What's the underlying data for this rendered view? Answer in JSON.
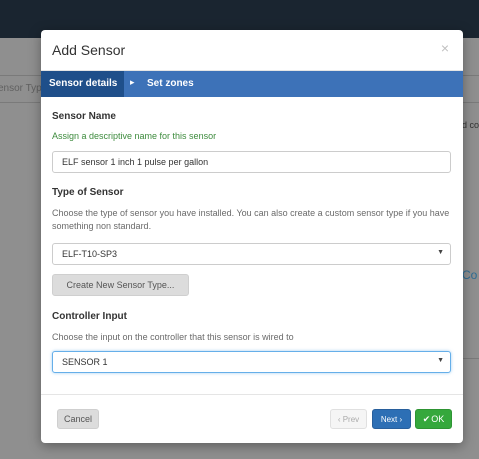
{
  "background": {
    "left_fragment": "ensor Typ",
    "right_fragment_1": "d co",
    "right_fragment_2": "Co"
  },
  "modal": {
    "title": "Add Sensor",
    "close_glyph": "×"
  },
  "wizard": {
    "steps": [
      {
        "label": "Sensor details",
        "active": true
      },
      {
        "label": "Set zones",
        "active": false
      }
    ],
    "arrow_glyph": "▸"
  },
  "sensor_name": {
    "heading": "Sensor Name",
    "help": "Assign a descriptive name for this sensor",
    "value": "ELF sensor 1 inch  1 pulse per gallon"
  },
  "sensor_type": {
    "heading": "Type of Sensor",
    "help": "Choose the type of sensor you have installed. You can also create a custom sensor type if you have something non standard.",
    "selected": "ELF-T10-SP3",
    "create_button": "Create New Sensor Type..."
  },
  "controller_input": {
    "heading": "Controller Input",
    "help": "Choose the input on the controller that this sensor is wired to",
    "selected": "SENSOR 1"
  },
  "footer": {
    "cancel_label": "Cancel",
    "prev_label": "‹ Prev",
    "next_label": "Next ›",
    "ok_label": "OK",
    "check_glyph": "✔"
  },
  "colors": {
    "wizard_bar": "#3d72b8",
    "wizard_active": "#1f4f8a",
    "help_green": "#3d8b3d",
    "next_button": "#2d6fb5",
    "ok_button": "#35a83c"
  },
  "icons": {
    "close": "close-icon",
    "step_arrow": "chevron-right-icon",
    "select_caret": "caret-down-icon",
    "ok_check": "check-icon"
  }
}
